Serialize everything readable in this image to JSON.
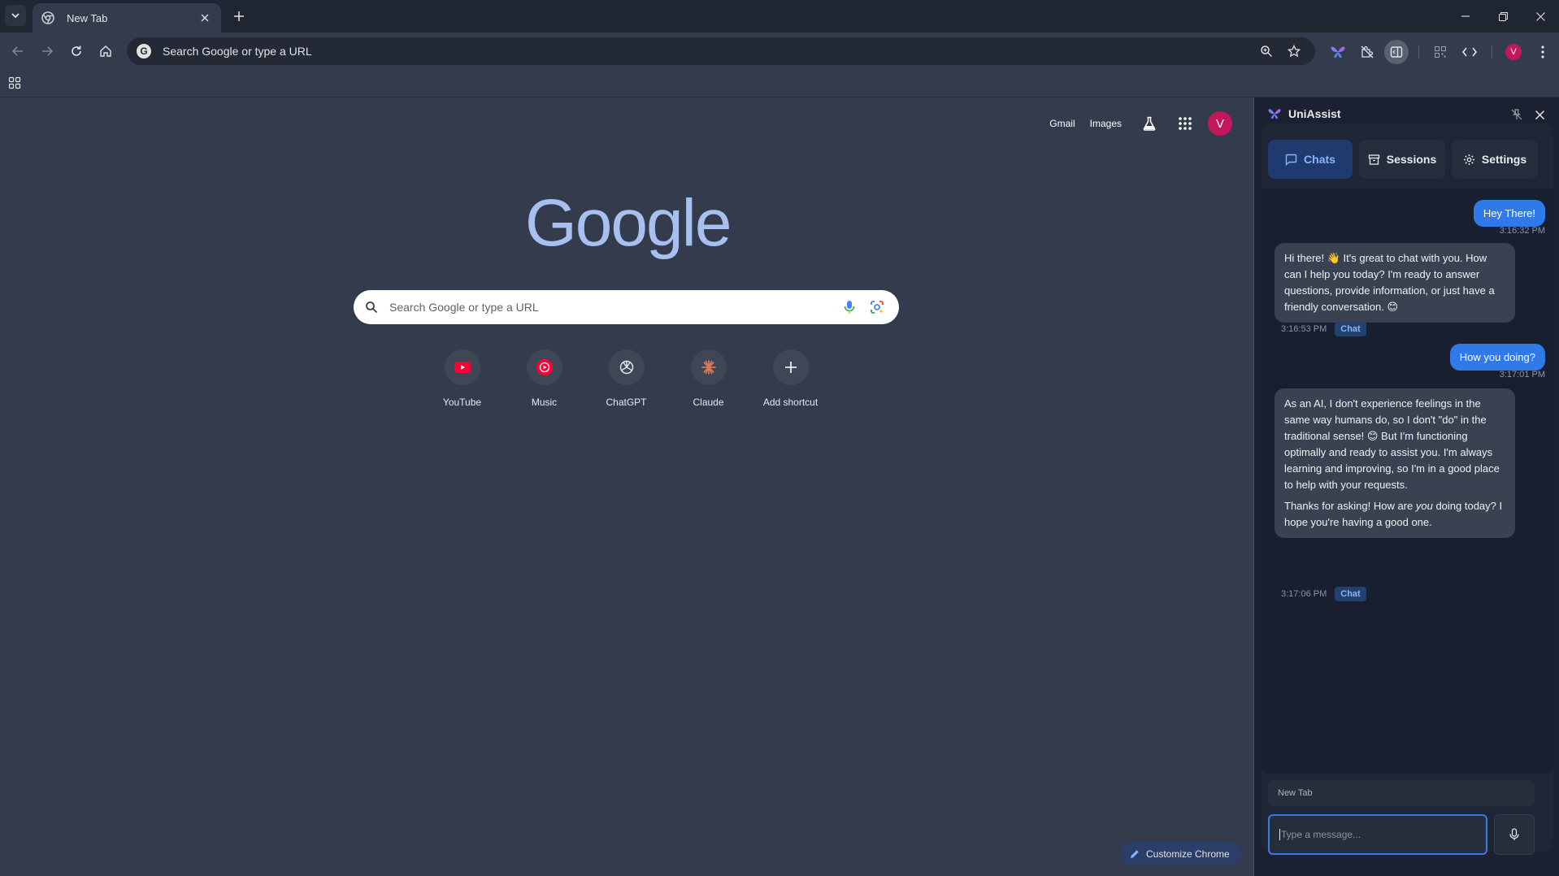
{
  "browser": {
    "tab_title": "New Tab",
    "omnibox_placeholder": "Search Google or type a URL",
    "profile_initial": "V"
  },
  "ntp": {
    "links": [
      "Gmail",
      "Images"
    ],
    "profile_initial": "V",
    "logo_text": "Google",
    "search_placeholder": "Search Google or type a URL",
    "shortcuts": [
      {
        "label": "YouTube",
        "icon": "youtube-icon"
      },
      {
        "label": "Music",
        "icon": "youtube-music-icon"
      },
      {
        "label": "ChatGPT",
        "icon": "chatgpt-icon"
      },
      {
        "label": "Claude",
        "icon": "claude-icon"
      },
      {
        "label": "Add shortcut",
        "icon": "plus-icon"
      }
    ],
    "customize_label": "Customize Chrome"
  },
  "panel": {
    "name": "UniAssist",
    "tabs": [
      "Chats",
      "Sessions",
      "Settings"
    ],
    "active_tab": "Chats",
    "messages": [
      {
        "role": "user",
        "text": "Hey There!",
        "time": "3:16:32 PM"
      },
      {
        "role": "assistant",
        "p1": "Hi there! 👋 It's great to chat with you. How can I help you today? I'm ready to answer questions, provide information, or just have a friendly conversation. 😊",
        "time": "3:16:53 PM",
        "badge": "Chat"
      },
      {
        "role": "user",
        "text": "How you doing?",
        "time": "3:17:01 PM"
      },
      {
        "role": "assistant",
        "p1": "As an AI, I don't experience feelings in the same way humans do, so I don't \"do\" in the traditional sense! 😊 But I'm functioning optimally and ready to assist you. I'm always learning and improving, so I'm in a good place to help with your requests.",
        "p2_a": "Thanks for asking! How are ",
        "p2_em": "you",
        "p2_b": " doing today? I hope you're having a good one.",
        "time": "3:17:06 PM",
        "badge": "Chat"
      }
    ],
    "context_tab": "New Tab",
    "input_placeholder": "Type a message..."
  },
  "colors": {
    "accent": "#8ab4f8",
    "user_bubble": "#2f7ae8",
    "avatar": "#c2185b"
  }
}
